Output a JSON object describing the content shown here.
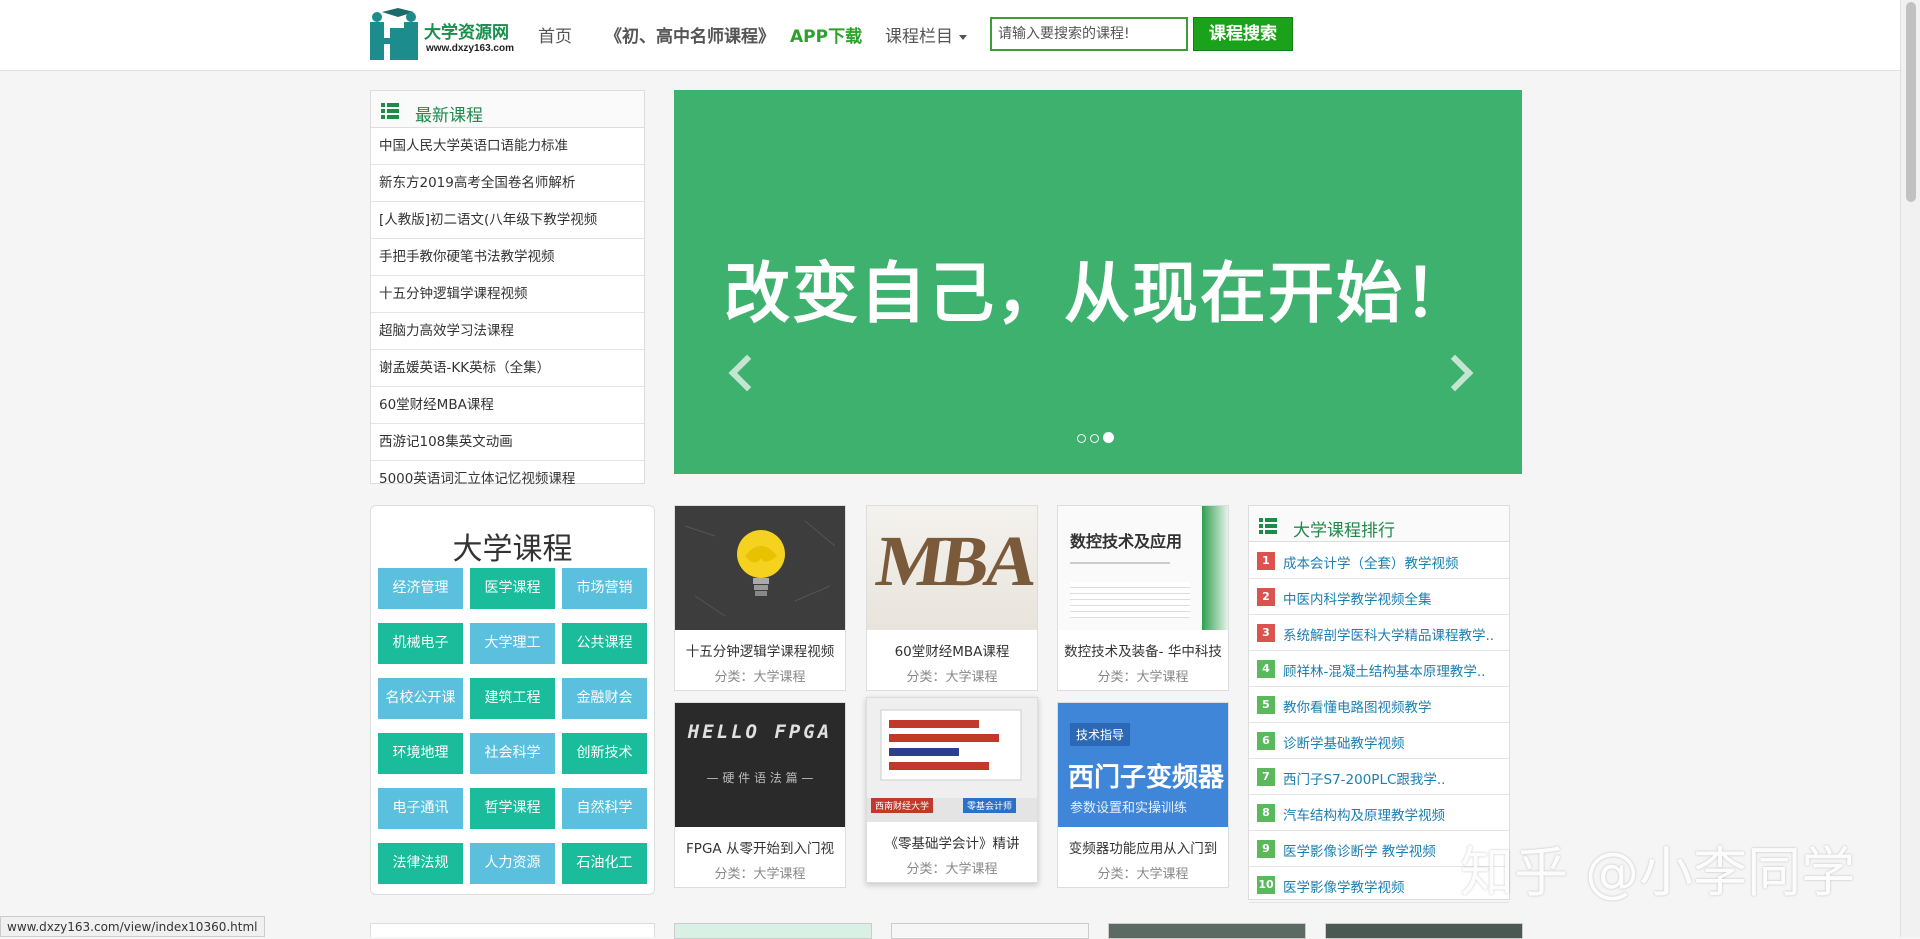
{
  "logo": {
    "name": "大学资源网",
    "url": "www.dxzy163.com"
  },
  "nav": {
    "home": "首页",
    "masters": "《初、高中名师课程》",
    "app": "APP下载",
    "columns": "课程栏目"
  },
  "search": {
    "placeholder": "请输入要搜索的课程!",
    "button": "课程搜索"
  },
  "latest": {
    "title": "最新课程",
    "items": [
      "中国人民大学英语口语能力标准",
      "新东方2019高考全国卷名师解析",
      "[人教版]初二语文(八年级下教学视频",
      "手把手教你硬笔书法教学视频",
      "十五分钟逻辑学课程视频",
      "超脑力高效学习法课程",
      "谢孟媛英语-KK英标（全集）",
      "60堂财经MBA课程",
      "西游记108集英文动画",
      "5000英语词汇立体记忆视频课程"
    ]
  },
  "banner": {
    "text": "改变自己，从现在开始！",
    "slides": 3,
    "active_slide": 3
  },
  "university": {
    "title": "大学课程",
    "categories": [
      {
        "label": "经济管理",
        "color": "blue"
      },
      {
        "label": "医学课程",
        "color": "teal"
      },
      {
        "label": "市场营销",
        "color": "blue"
      },
      {
        "label": "机械电子",
        "color": "teal"
      },
      {
        "label": "大学理工",
        "color": "blue"
      },
      {
        "label": "公共课程",
        "color": "teal"
      },
      {
        "label": "名校公开课",
        "color": "blue"
      },
      {
        "label": "建筑工程",
        "color": "teal"
      },
      {
        "label": "金融财会",
        "color": "blue"
      },
      {
        "label": "环境地理",
        "color": "teal"
      },
      {
        "label": "社会科学",
        "color": "blue"
      },
      {
        "label": "创新技术",
        "color": "teal"
      },
      {
        "label": "电子通讯",
        "color": "blue"
      },
      {
        "label": "哲学课程",
        "color": "teal"
      },
      {
        "label": "自然科学",
        "color": "blue"
      },
      {
        "label": "法律法规",
        "color": "teal"
      },
      {
        "label": "人力资源",
        "color": "blue"
      },
      {
        "label": "石油化工",
        "color": "teal"
      }
    ]
  },
  "cards": [
    {
      "title": "十五分钟逻辑学课程视频",
      "meta": "分类：大学课程"
    },
    {
      "title": "60堂财经MBA课程",
      "meta": "分类：大学课程",
      "thumb_text": "MBA"
    },
    {
      "title": "数控技术及装备- 华中科技",
      "meta": "分类：大学课程",
      "thumb_text": "数控技术及应用"
    },
    {
      "title": "FPGA 从零开始到入门视",
      "meta": "分类：大学课程",
      "thumb_text": "HELLO FPGA",
      "thumb_sub": "— 硬 件 语 法 篇 —"
    },
    {
      "title": "《零基础学会计》精讲",
      "meta": "分类：大学课程",
      "thumb_tag1": "西南财经大学",
      "thumb_tag2": "零基会计师"
    },
    {
      "title": "变频器功能应用从入门到",
      "meta": "分类：大学课程",
      "thumb_tag": "技术指导",
      "thumb_text": "西门子变频器",
      "thumb_sub": "参数设置和实操训练"
    }
  ],
  "ranking": {
    "title": "大学课程排行",
    "items": [
      {
        "num": "1",
        "label": "成本会计学（全套）教学视频",
        "color": "#d9534f"
      },
      {
        "num": "2",
        "label": "中医内科学教学视频全集",
        "color": "#d9534f"
      },
      {
        "num": "3",
        "label": "系统解剖学医科大学精品课程教学..",
        "color": "#d9534f"
      },
      {
        "num": "4",
        "label": "顾祥林-混凝土结构基本原理教学..",
        "color": "#5cb85c"
      },
      {
        "num": "5",
        "label": "教你看懂电路图视频教学",
        "color": "#5cb85c"
      },
      {
        "num": "6",
        "label": "诊断学基础教学视频",
        "color": "#5cb85c"
      },
      {
        "num": "7",
        "label": "西门子S7-200PLC跟我学..",
        "color": "#5cb85c"
      },
      {
        "num": "8",
        "label": "汽车结构构及原理教学视频",
        "color": "#5cb85c"
      },
      {
        "num": "9",
        "label": "医学影像诊断学 教学视频",
        "color": "#5cb85c"
      },
      {
        "num": "10",
        "label": "医学影像学教学视频",
        "color": "#5cb85c"
      }
    ]
  },
  "status_bar": "www.dxzy163.com/view/index10360.html",
  "watermark": "知乎 @小李同学"
}
